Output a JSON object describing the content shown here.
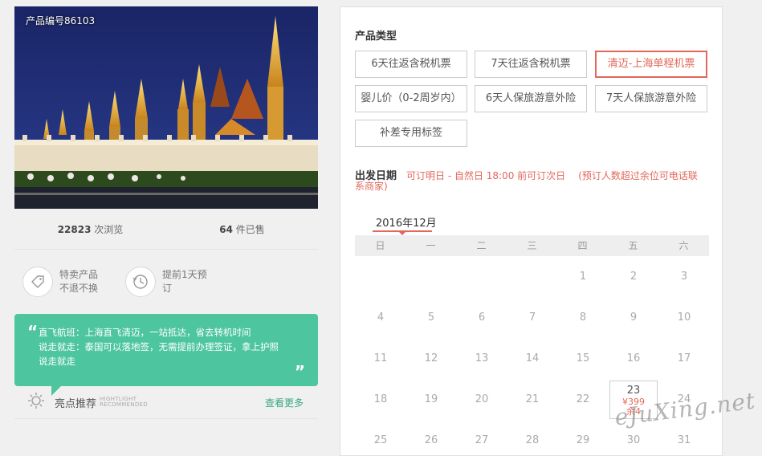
{
  "product": {
    "id_label": "产品编号86103",
    "views_count": "22823",
    "views_unit": "次浏览",
    "sold_count": "64",
    "sold_unit": "件已售"
  },
  "features": [
    {
      "icon": "tag-icon",
      "line1": "特卖产品",
      "line2": "不退不换"
    },
    {
      "icon": "clock-icon",
      "line1": "提前1天预",
      "line2": "订"
    }
  ],
  "quote": {
    "open": "“",
    "close": "”",
    "lines": [
      "直飞航班：上海直飞清迈，一站抵达，省去转机时间",
      "说走就走：泰国可以落地签，无需提前办理签证，拿上护照",
      "说走就走"
    ]
  },
  "highlight": {
    "title": "亮点推荐",
    "en1": "HIGHTLIGHT",
    "en2": "RECOMMENDED",
    "more": "查看更多"
  },
  "types": {
    "title": "产品类型",
    "items": [
      "6天往返含税机票",
      "7天往返含税机票",
      "清迈-上海单程机票",
      "婴儿价（0-2周岁内）",
      "6天人保旅游意外险",
      "7天人保旅游意外险",
      "补差专用标签"
    ],
    "selected_index": 2
  },
  "departure": {
    "label": "出发日期",
    "rule": "可订明日 - 自然日 18:00 前可订次日",
    "note": "(预订人数超过余位可电话联系商家)"
  },
  "calendar": {
    "month": "2016年12月",
    "weekdays": [
      "日",
      "一",
      "二",
      "三",
      "四",
      "五",
      "六"
    ],
    "rows": [
      [
        "",
        "",
        "",
        "",
        "1",
        "2",
        "3"
      ],
      [
        "4",
        "5",
        "6",
        "7",
        "8",
        "9",
        "10"
      ],
      [
        "11",
        "12",
        "13",
        "14",
        "15",
        "16",
        "17"
      ],
      [
        "18",
        "19",
        "20",
        "21",
        "22",
        "23",
        "24"
      ],
      [
        "25",
        "26",
        "27",
        "28",
        "29",
        "30",
        "31"
      ]
    ],
    "available": {
      "day": "23",
      "price": "¥399",
      "stock": "余4"
    }
  },
  "watermark": "eJuXing.net",
  "colors": {
    "accent": "#e2685a",
    "green": "#4dc59f"
  }
}
